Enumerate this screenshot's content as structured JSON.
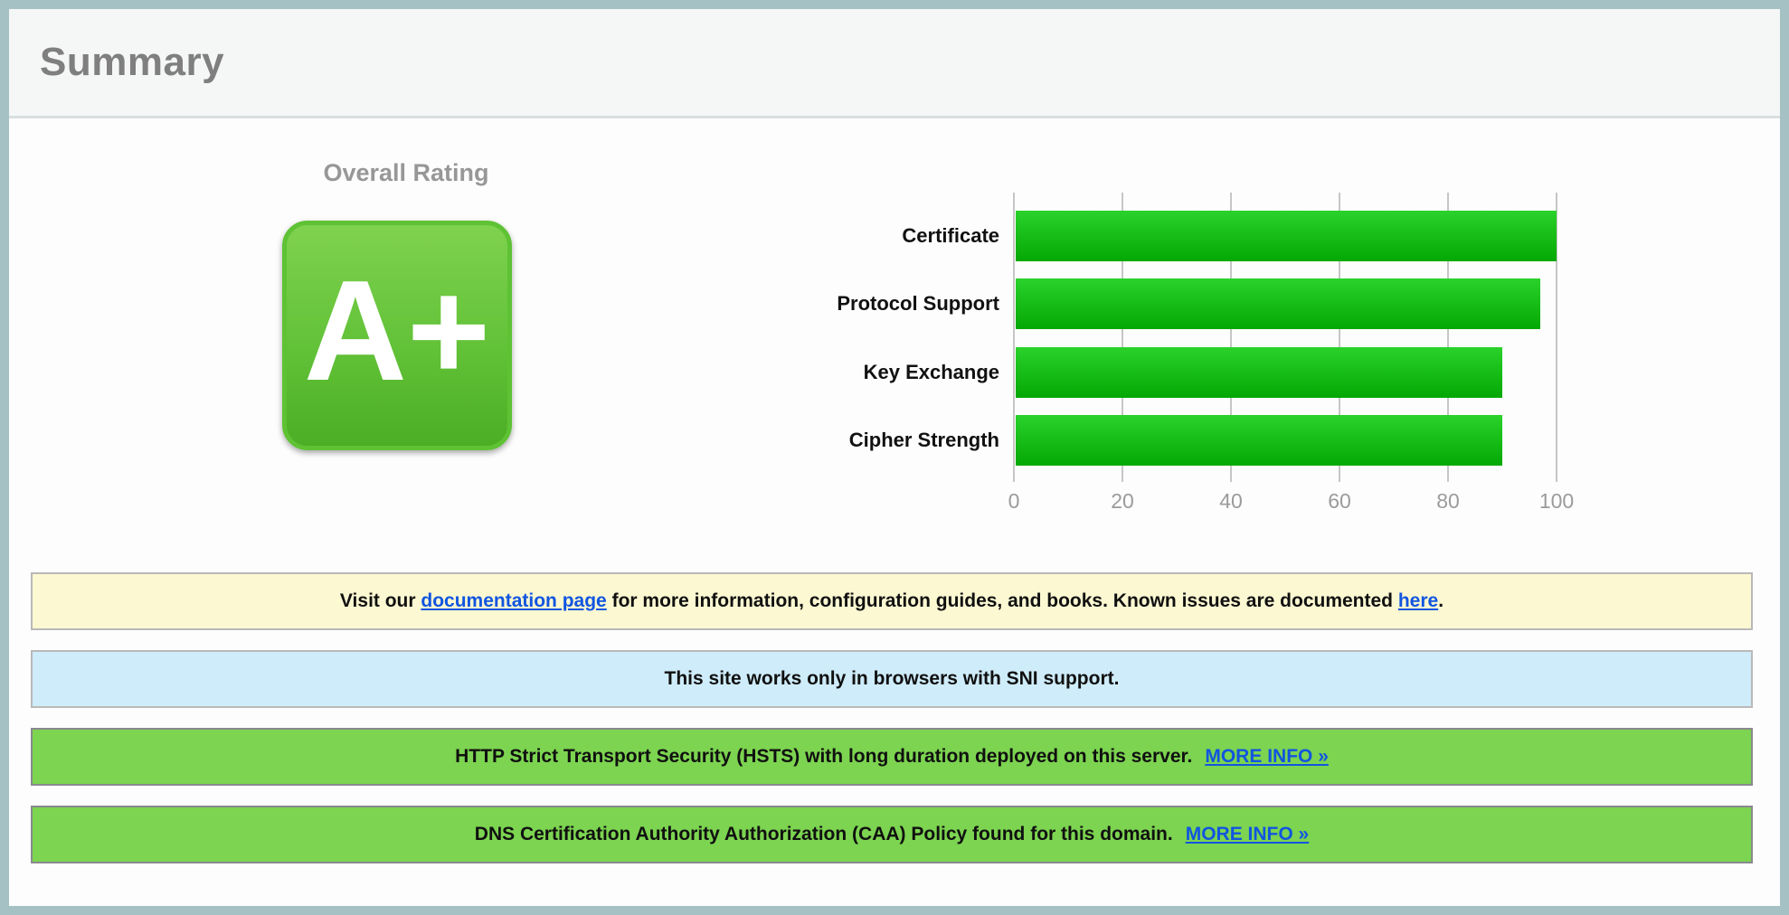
{
  "header": {
    "title": "Summary"
  },
  "overall_rating": {
    "label": "Overall Rating",
    "grade": "A+"
  },
  "chart_data": {
    "type": "bar",
    "orientation": "horizontal",
    "title": "",
    "xlabel": "",
    "ylabel": "",
    "categories": [
      "Certificate",
      "Protocol Support",
      "Key Exchange",
      "Cipher Strength"
    ],
    "values": [
      100,
      97,
      90,
      90
    ],
    "xlim": [
      0,
      100
    ],
    "xticks": [
      0,
      20,
      40,
      60,
      80,
      100
    ],
    "grid": true,
    "legend": "none"
  },
  "messages": {
    "documentation": {
      "text_before": "Visit our ",
      "doc_link_label": "documentation page",
      "text_middle": " for more information, configuration guides, and books. Known issues are documented ",
      "issues_link_label": "here",
      "text_after": "."
    },
    "sni": {
      "text": "This site works only in browsers with SNI support."
    },
    "hsts": {
      "text": "HTTP Strict Transport Security (HSTS) with long duration deployed on this server.",
      "more_info_label": "MORE INFO »"
    },
    "caa": {
      "text": "DNS Certification Authority Authorization (CAA) Policy found for this domain.",
      "more_info_label": "MORE INFO »"
    }
  },
  "colors": {
    "frame_border": "#a6c1c4",
    "header_bg": "#f5f6f6",
    "header_text": "#7f7f7f",
    "grade_green_top": "#7fd24e",
    "grade_green_bottom": "#4cae24",
    "bar_green_top": "#2bd22b",
    "bar_green_bottom": "#04a804",
    "box_yellow": "#fcf8d2",
    "box_blue": "#cfecfa",
    "box_green": "#7cd450",
    "link_blue": "#1155e0"
  }
}
